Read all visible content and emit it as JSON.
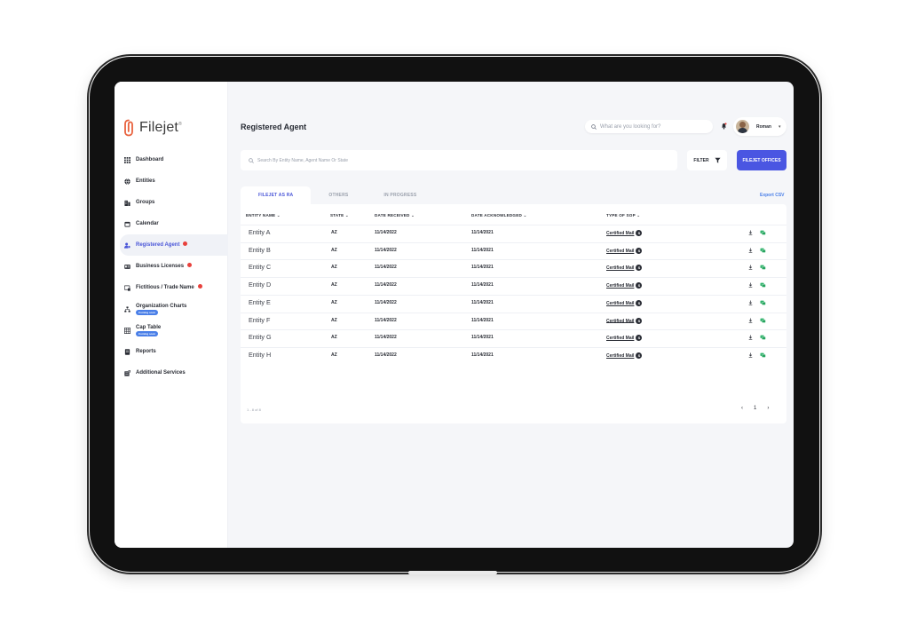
{
  "app": {
    "name": "Filejet",
    "tm": "®"
  },
  "sidebar": {
    "items": [
      {
        "label": "Dashboard",
        "icon": "grid-icon"
      },
      {
        "label": "Entities",
        "icon": "globe-icon"
      },
      {
        "label": "Groups",
        "icon": "building-icon"
      },
      {
        "label": "Calendar",
        "icon": "calendar-icon"
      },
      {
        "label": "Registered Agent",
        "icon": "users-icon",
        "active": true,
        "alert": true
      },
      {
        "label": "Business Licenses",
        "icon": "id-card-icon",
        "alert": true
      },
      {
        "label": "Fictitious / Trade Name",
        "icon": "tag-icon",
        "alert": true
      },
      {
        "label": "Organization Charts",
        "icon": "org-chart-icon",
        "soon": "Coming soon"
      },
      {
        "label": "Cap Table",
        "icon": "table-icon",
        "soon": "Coming soon"
      },
      {
        "label": "Reports",
        "icon": "report-icon"
      },
      {
        "label": "Additional Services",
        "icon": "services-icon"
      }
    ]
  },
  "header": {
    "title": "Registered Agent",
    "search_placeholder": "What are you looking for?",
    "user_name": "Roman"
  },
  "toolbar": {
    "search_placeholder": "Search By Entity Name, Agent Name Or State",
    "filter_label": "FILTER",
    "offices_label": "FILEJET OFFICES"
  },
  "tabs": [
    {
      "label": "FILEJET AS RA",
      "active": true
    },
    {
      "label": "OTHERS"
    },
    {
      "label": "IN PROGRESS"
    }
  ],
  "export_label": "Export CSV",
  "table": {
    "columns": [
      "ENTITY NAME",
      "STATE",
      "DATE RECEIVED",
      "DATE ACKNOWLEDGED",
      "TYPE OF SOP"
    ],
    "rows": [
      {
        "entity": "Entity A",
        "state": "AZ",
        "received": "11/14/2022",
        "acknowledged": "11/14/2021",
        "sop": "Certified Mail"
      },
      {
        "entity": "Entity B",
        "state": "AZ",
        "received": "11/14/2022",
        "acknowledged": "11/14/2021",
        "sop": "Certified Mail"
      },
      {
        "entity": "Entity C",
        "state": "AZ",
        "received": "11/14/2022",
        "acknowledged": "11/14/2021",
        "sop": "Certified Mail"
      },
      {
        "entity": "Entity D",
        "state": "AZ",
        "received": "11/14/2022",
        "acknowledged": "11/14/2021",
        "sop": "Certified Mail"
      },
      {
        "entity": "Entity E",
        "state": "AZ",
        "received": "11/14/2022",
        "acknowledged": "11/14/2021",
        "sop": "Certified Mail"
      },
      {
        "entity": "Entity F",
        "state": "AZ",
        "received": "11/14/2022",
        "acknowledged": "11/14/2021",
        "sop": "Certified Mail"
      },
      {
        "entity": "Entity G",
        "state": "AZ",
        "received": "11/14/2022",
        "acknowledged": "11/14/2021",
        "sop": "Certified Mail"
      },
      {
        "entity": "Entity H",
        "state": "AZ",
        "received": "11/14/2022",
        "acknowledged": "11/14/2021",
        "sop": "Certified Mail"
      }
    ],
    "sop_dot": "S"
  },
  "pagination": {
    "summary": "1 - 8 of 8",
    "prev": "‹",
    "page": "1",
    "next": "›"
  }
}
